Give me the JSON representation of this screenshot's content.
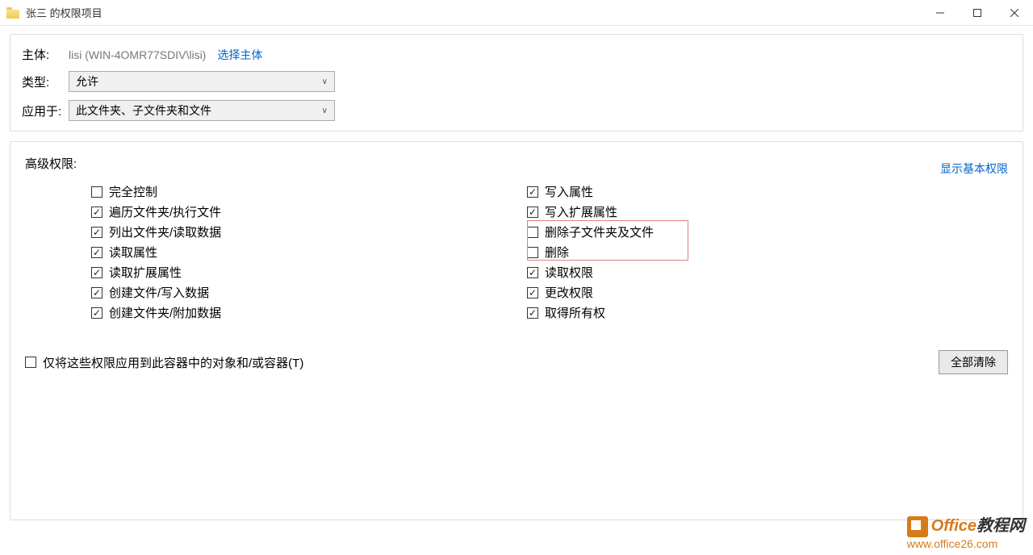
{
  "window": {
    "title": "张三 的权限项目",
    "minimize_icon": "minimize-icon",
    "maximize_icon": "maximize-icon",
    "close_icon": "close-icon"
  },
  "header": {
    "principal_label": "主体:",
    "principal_value": "lisi (WIN-4OMR77SDIV\\lisi)",
    "select_principal_link": "选择主体",
    "type_label": "类型:",
    "type_value": "允许",
    "applies_label": "应用于:",
    "applies_value": "此文件夹、子文件夹和文件"
  },
  "advanced": {
    "title": "高级权限:",
    "show_basic_link": "显示基本权限"
  },
  "permissions_left": [
    {
      "label": "完全控制",
      "checked": false
    },
    {
      "label": "遍历文件夹/执行文件",
      "checked": true
    },
    {
      "label": "列出文件夹/读取数据",
      "checked": true
    },
    {
      "label": "读取属性",
      "checked": true
    },
    {
      "label": "读取扩展属性",
      "checked": true
    },
    {
      "label": "创建文件/写入数据",
      "checked": true
    },
    {
      "label": "创建文件夹/附加数据",
      "checked": true
    }
  ],
  "permissions_right": [
    {
      "label": "写入属性",
      "checked": true
    },
    {
      "label": "写入扩展属性",
      "checked": true
    },
    {
      "label": "删除子文件夹及文件",
      "checked": false
    },
    {
      "label": "删除",
      "checked": false
    },
    {
      "label": "读取权限",
      "checked": true
    },
    {
      "label": "更改权限",
      "checked": true
    },
    {
      "label": "取得所有权",
      "checked": true
    }
  ],
  "only_apply": {
    "label": "仅将这些权限应用到此容器中的对象和/或容器(T)",
    "checked": false
  },
  "clear_all_btn": "全部清除",
  "watermark": {
    "line1_brand": "Office",
    "line1_text": "教程网",
    "line2": "www.office26.com"
  }
}
